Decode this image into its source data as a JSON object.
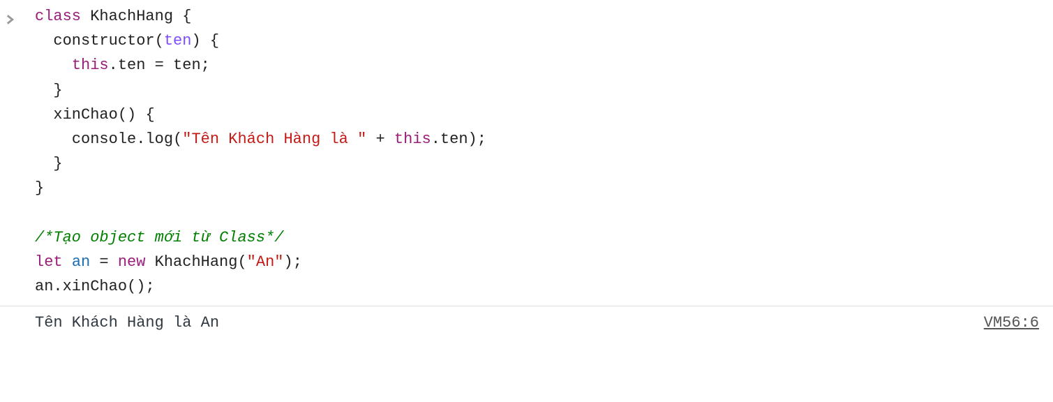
{
  "code": {
    "kw_class": "class",
    "class_name": "KhachHang",
    "brace_open": "{",
    "ctor_name": "constructor",
    "paren_open": "(",
    "ctor_param": "ten",
    "paren_close": ")",
    "this_kw": "this",
    "dot": ".",
    "prop_ten": "ten",
    "equals": " = ",
    "semicolon": ";",
    "brace_close": "}",
    "method_name": "xinChao",
    "empty_parens": "()",
    "console_ident": "console",
    "log_ident": "log",
    "log_string": "\"Tên Khách Hàng là \"",
    "plus": " + ",
    "comment": "/*Tạo object mới từ Class*/",
    "kw_let": "let",
    "var_an": "an",
    "eq2": " = ",
    "kw_new": "new",
    "ctor_call_name": "KhachHang",
    "arg_an": "\"An\"",
    "call_an": "an",
    "call_method": "xinChao"
  },
  "output": {
    "text": "Tên Khách Hàng là An",
    "source": "VM56:6"
  }
}
